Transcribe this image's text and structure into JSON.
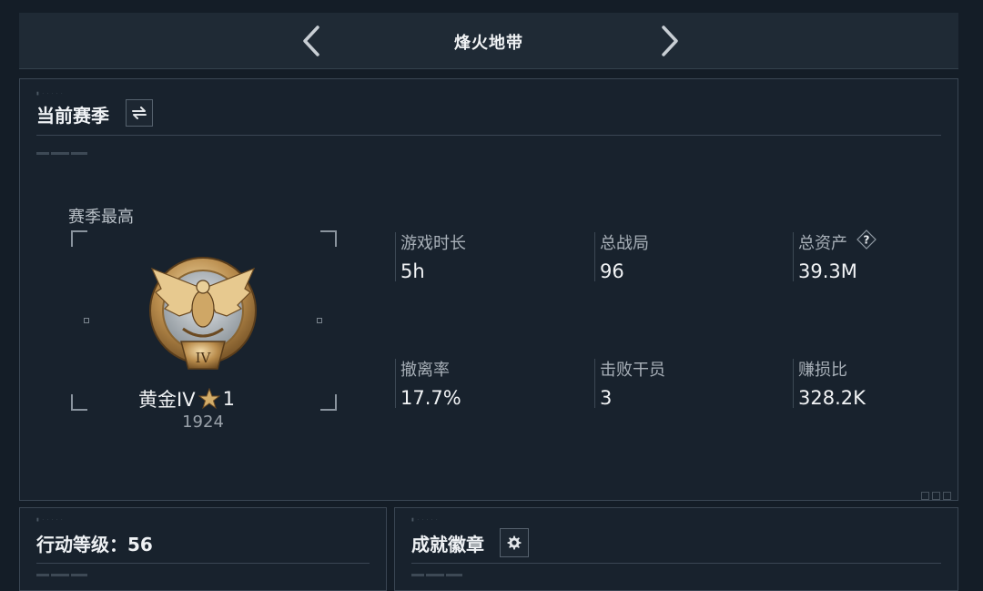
{
  "header": {
    "mode_title": "烽火地带",
    "prev_icon": "chevron-left-icon",
    "next_icon": "chevron-right-icon"
  },
  "season_panel": {
    "title": "当前赛季",
    "switch_icon": "swap-arrows-icon",
    "best_label": "赛季最高",
    "rank": {
      "badge_icon": "gold-eagle-rank-badge",
      "badge_numeral": "IV",
      "name": "黄金IV",
      "star_icon": "star-icon",
      "stars": "1",
      "score": "1924"
    },
    "stats": [
      {
        "label": "游戏时长",
        "value": "5h"
      },
      {
        "label": "总战局",
        "value": "96"
      },
      {
        "label": "总资产",
        "value": "39.3M",
        "help_icon": "question-mark-icon",
        "help_text": "?"
      },
      {
        "label": "撤离率",
        "value": "17.7%"
      },
      {
        "label": "击败干员",
        "value": "3"
      },
      {
        "label": "赚损比",
        "value": "328.2K"
      }
    ]
  },
  "level_panel": {
    "title": "行动等级：56"
  },
  "badges_panel": {
    "title": "成就徽章",
    "settings_icon": "gear-icon"
  },
  "colors": {
    "background": "#141d27",
    "panel": "#18222d",
    "border": "#3a4653",
    "text_primary": "#f1f3f5",
    "text_secondary": "#a8b0b8",
    "gold": "#c9a15e"
  }
}
